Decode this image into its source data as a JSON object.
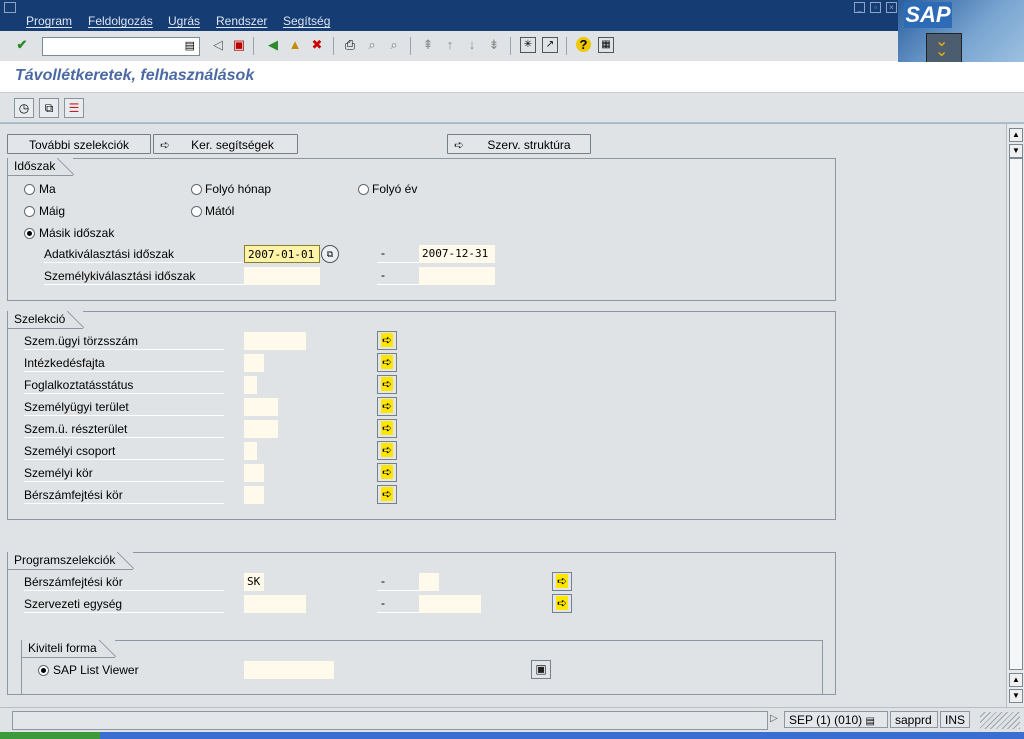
{
  "menu": [
    "Program",
    "Feldolgozás",
    "Ugrás",
    "Rendszer",
    "Segítség"
  ],
  "brand": {
    "logo_text": "SAP"
  },
  "toolbar": {
    "command_field_value": "",
    "icons": [
      "enter-icon",
      "back-nav-icon",
      "save-icon",
      "back-icon",
      "exit-icon",
      "cancel-icon",
      "print-icon",
      "find-icon",
      "find-next-icon",
      "first-page-icon",
      "prev-page-icon",
      "next-page-icon",
      "last-page-icon",
      "new-session-icon",
      "shortcut-icon",
      "help-icon",
      "layout-icon"
    ]
  },
  "screen_title": "Távollétkeretek, felhasználások",
  "app_toolbar": {
    "icons": [
      "execute-icon",
      "get-variant-icon",
      "selection-options-icon"
    ]
  },
  "buttons": {
    "more_selections": "További szelekciók",
    "search_helps": "Ker. segítségek",
    "org_structure": "Szerv. struktúra"
  },
  "period": {
    "title": "Időszak",
    "radios": [
      {
        "label": "Ma",
        "selected": false
      },
      {
        "label": "Folyó hónap",
        "selected": false
      },
      {
        "label": "Folyó év",
        "selected": false
      },
      {
        "label": "Máig",
        "selected": false
      },
      {
        "label": "Mától",
        "selected": false
      },
      {
        "label": "Másik időszak",
        "selected": true
      }
    ],
    "data_selection_label": "Adatkiválasztási időszak",
    "data_selection_from": "2007-01-01",
    "data_selection_to": "2007-12-31",
    "person_selection_label": "Személykiválasztási időszak",
    "person_selection_from": "",
    "person_selection_to": "",
    "range_dash": "-"
  },
  "selection": {
    "title": "Szelekció",
    "rows": [
      {
        "label": "Szem.ügyi törzsszám",
        "value": ""
      },
      {
        "label": "Intézkedésfajta",
        "value": ""
      },
      {
        "label": "Foglalkoztatásstátus",
        "value": ""
      },
      {
        "label": "Személyügyi terület",
        "value": ""
      },
      {
        "label": "Szem.ü. részterület",
        "value": ""
      },
      {
        "label": "Személyi csoport",
        "value": ""
      },
      {
        "label": "Személyi kör",
        "value": ""
      },
      {
        "label": "Bérszámfejtési kör",
        "value": ""
      }
    ]
  },
  "program_selection": {
    "title": "Programszelekciók",
    "rows": [
      {
        "label": "Bérszámfejtési kör",
        "from": "SK",
        "to": ""
      },
      {
        "label": "Szervezeti egység",
        "from": "",
        "to": ""
      }
    ],
    "range_dash": "-"
  },
  "output_format": {
    "title": "Kiviteli forma",
    "option_label": "SAP List Viewer",
    "option_selected": true,
    "layout_value": ""
  },
  "status": {
    "message": "",
    "system": "SEP (1) (010)",
    "server": "sapprd",
    "mode": "INS"
  }
}
